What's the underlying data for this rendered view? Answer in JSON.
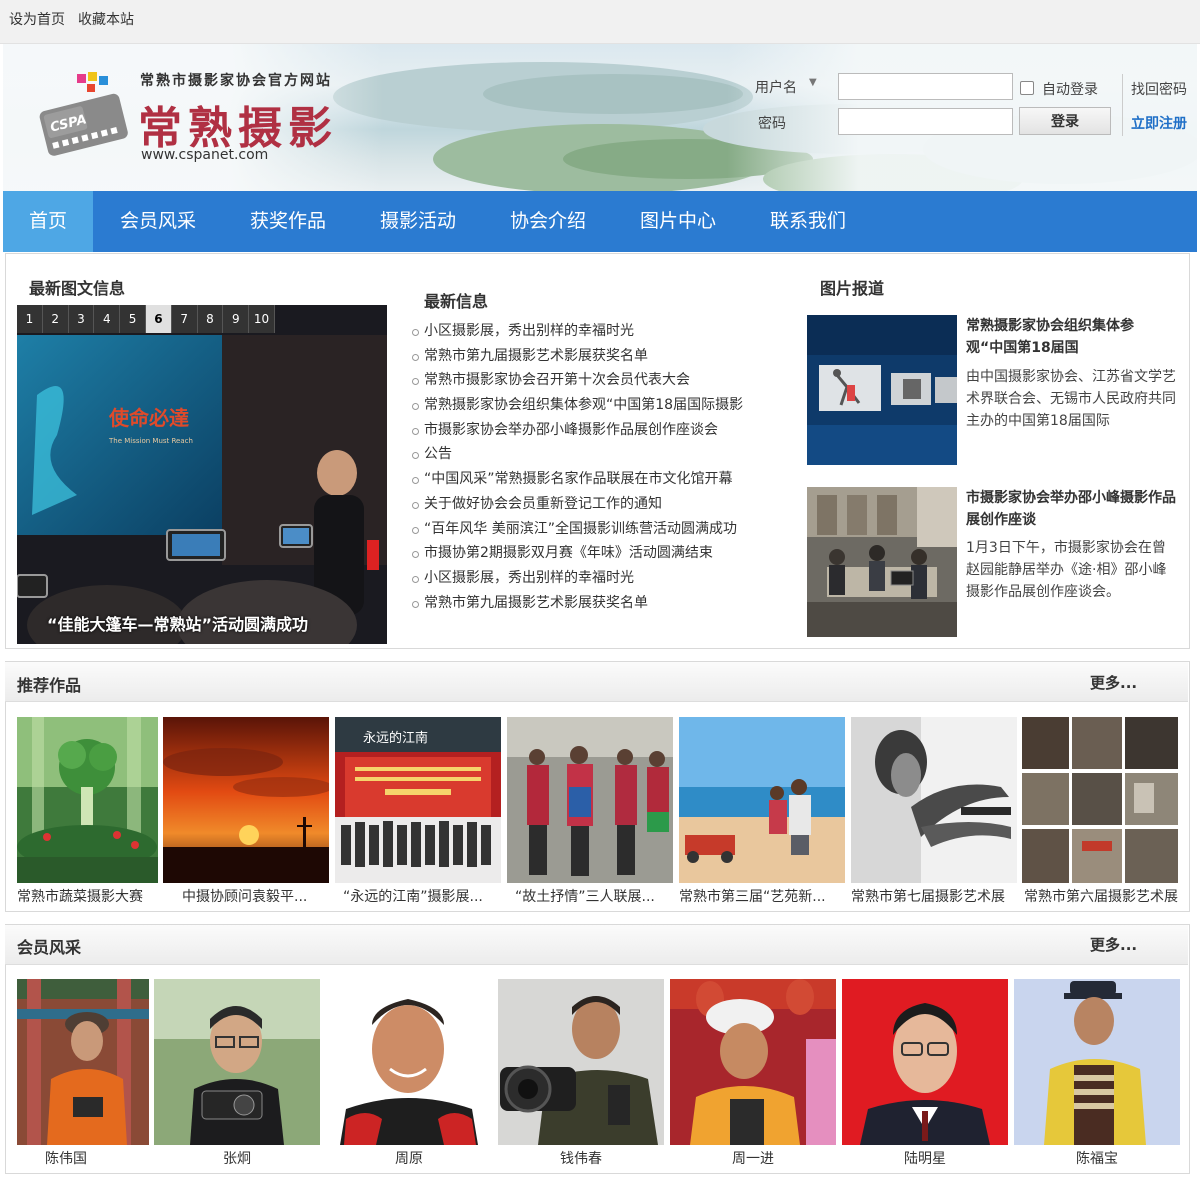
{
  "topbar": {
    "home_link": "设为首页",
    "fav_link": "收藏本站"
  },
  "header": {
    "site_tag": "常熟市摄影家协会官方网站",
    "site_name": "常熟摄影",
    "site_url": "www.cspanet.com",
    "logo_text": "CSPA"
  },
  "login": {
    "username_label": "用户名",
    "password_label": "密码",
    "auto_login": "自动登录",
    "login_button": "登录",
    "forgot_password": "找回密码",
    "register": "立即注册"
  },
  "nav": {
    "items": [
      "首页",
      "会员风采",
      "获奖作品",
      "摄影活动",
      "协会介绍",
      "图片中心",
      "联系我们"
    ],
    "active_index": 0,
    "color": "#2b7bd1",
    "active_color": "#4ea7e5"
  },
  "latest_pictures": {
    "title": "最新图文信息",
    "pages": [
      "1",
      "2",
      "3",
      "4",
      "5",
      "6",
      "7",
      "8",
      "9",
      "10"
    ],
    "active_page": "6",
    "caption": "“佳能大篷车—常熟站”活动圆满成功",
    "screen_text": "使命必達",
    "screen_subtext": "The Mission Must Reach"
  },
  "latest_news": {
    "title": "最新信息",
    "items": [
      "小区摄影展，秀出别样的幸福时光",
      "常熟市第九届摄影艺术影展获奖名单",
      "常熟市摄影家协会召开第十次会员代表大会",
      "常熟摄影家协会组织集体参观“中国第18届国际摄影",
      "市摄影家协会举办邵小峰摄影作品展创作座谈会",
      "公告",
      "“中国风采”常熟摄影名家作品联展在市文化馆开幕",
      "关于做好协会会员重新登记工作的通知",
      "“百年风华 美丽滨江”全国摄影训练营活动圆满成功",
      "市摄协第2期摄影双月赛《年味》活动圆满结束",
      "小区摄影展，秀出别样的幸福时光",
      "常熟市第九届摄影艺术影展获奖名单"
    ]
  },
  "photo_reports": {
    "title": "图片报道",
    "items": [
      {
        "title": "常熟摄影家协会组织集体参观“中国第18届国",
        "desc": "由中国摄影家协会、江苏省文学艺术界联合会、无锡市人民政府共同主办的中国第18届国际"
      },
      {
        "title": "市摄影家协会举办邵小峰摄影作品展创作座谈",
        "desc": "1月3日下午，市摄影家协会在曾赵园能静居举办《途·相》邵小峰摄影作品展创作座谈会。"
      }
    ]
  },
  "recommended": {
    "title": "推荐作品",
    "more": "更多...",
    "banner_text": "永远的江南",
    "items": [
      "常熟市蔬菜摄影大赛",
      "中摄协顾问袁毅平...",
      "“永远的江南”摄影展...",
      "“故土抒情”三人联展...",
      "常熟市第三届“艺苑新...",
      "常熟市第七届摄影艺术展",
      "常熟市第六届摄影艺术展"
    ]
  },
  "members": {
    "title": "会员风采",
    "more": "更多...",
    "items": [
      "陈伟国",
      "张炯",
      "周原",
      "钱伟春",
      "周一进",
      "陆明星",
      "陈福宝"
    ]
  }
}
